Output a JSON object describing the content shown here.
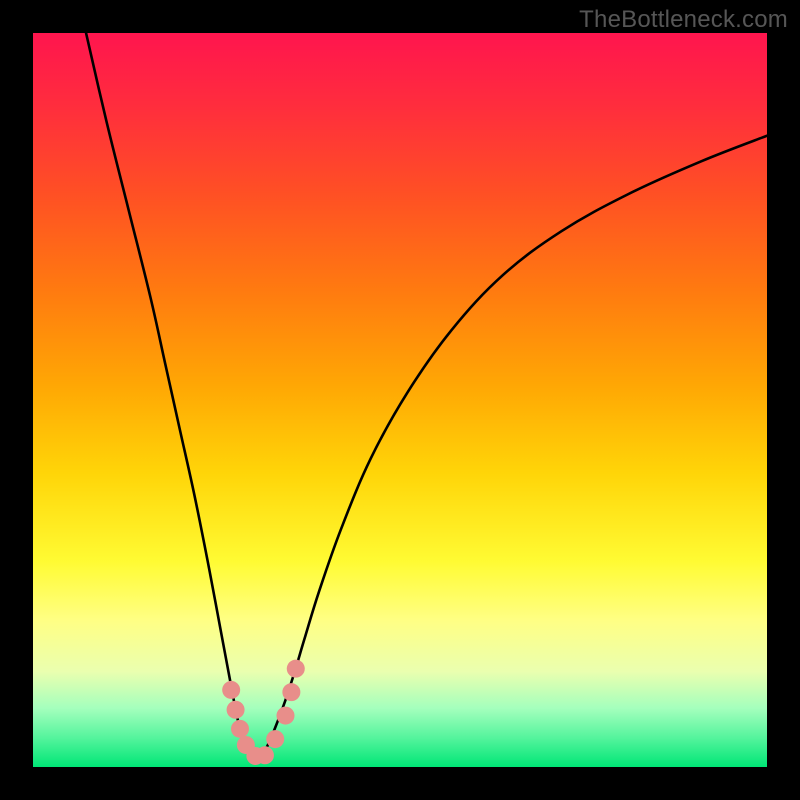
{
  "watermark": "TheBottleneck.com",
  "chart_data": {
    "type": "line",
    "title": "",
    "xlabel": "",
    "ylabel": "",
    "xlim": [
      0,
      100
    ],
    "ylim": [
      0,
      100
    ],
    "grid": false,
    "legend": false,
    "background_gradient": {
      "stops": [
        {
          "offset": 0.0,
          "color": "#ff154e"
        },
        {
          "offset": 0.1,
          "color": "#ff2d3d"
        },
        {
          "offset": 0.22,
          "color": "#ff5024"
        },
        {
          "offset": 0.35,
          "color": "#ff7a10"
        },
        {
          "offset": 0.48,
          "color": "#ffa704"
        },
        {
          "offset": 0.6,
          "color": "#ffd508"
        },
        {
          "offset": 0.72,
          "color": "#fffb33"
        },
        {
          "offset": 0.8,
          "color": "#ffff84"
        },
        {
          "offset": 0.87,
          "color": "#eaffaf"
        },
        {
          "offset": 0.92,
          "color": "#a4ffbd"
        },
        {
          "offset": 0.96,
          "color": "#55f49d"
        },
        {
          "offset": 1.0,
          "color": "#00e676"
        }
      ]
    },
    "series": [
      {
        "name": "curve",
        "color": "#000000",
        "x": [
          7,
          10,
          13,
          16,
          18,
          20,
          22,
          24,
          25.5,
          27,
          28,
          29,
          30,
          30.5,
          31,
          32,
          34,
          35.5,
          37,
          39,
          42,
          46,
          51,
          57,
          64,
          72,
          81,
          91,
          100
        ],
        "y": [
          101,
          88,
          76,
          64,
          55,
          46,
          37,
          27,
          19,
          11,
          6,
          3,
          1.5,
          1.2,
          1.5,
          3,
          8,
          12.5,
          17.5,
          24,
          32.5,
          42,
          51,
          59.5,
          67,
          73,
          78,
          82.5,
          86
        ]
      }
    ],
    "markers": {
      "color": "#e88e8a",
      "radius_px": 9,
      "points": [
        {
          "x": 27.0,
          "y": 10.5
        },
        {
          "x": 27.6,
          "y": 7.8
        },
        {
          "x": 28.2,
          "y": 5.2
        },
        {
          "x": 29.0,
          "y": 3.0
        },
        {
          "x": 30.3,
          "y": 1.5
        },
        {
          "x": 31.6,
          "y": 1.6
        },
        {
          "x": 33.0,
          "y": 3.8
        },
        {
          "x": 34.4,
          "y": 7.0
        },
        {
          "x": 35.2,
          "y": 10.2
        },
        {
          "x": 35.8,
          "y": 13.4
        }
      ]
    }
  }
}
